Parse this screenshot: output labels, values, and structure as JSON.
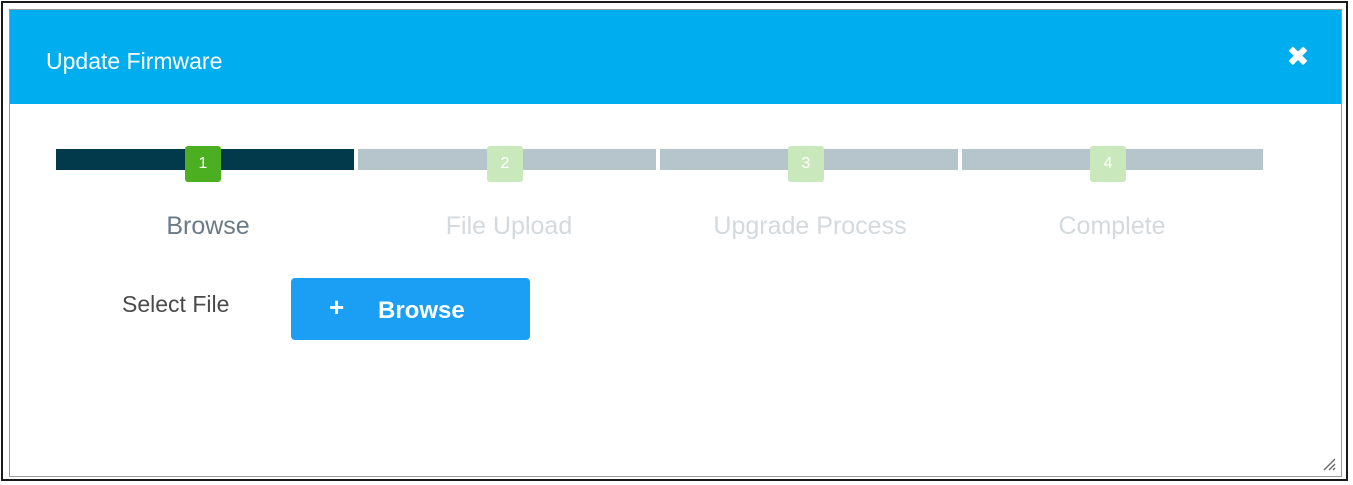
{
  "dialog": {
    "title": "Update Firmware",
    "close_icon": "close-icon",
    "close_glyph": "✖"
  },
  "stepper": {
    "current_step": 1,
    "steps": [
      {
        "number": "1",
        "label": "Browse",
        "state": "active"
      },
      {
        "number": "2",
        "label": "File Upload",
        "state": "inactive"
      },
      {
        "number": "3",
        "label": "Upgrade Process",
        "state": "inactive"
      },
      {
        "number": "4",
        "label": "Complete",
        "state": "inactive"
      }
    ]
  },
  "form": {
    "select_file_label": "Select File",
    "browse_button": {
      "icon": "plus-icon",
      "plus_glyph": "+",
      "label": "Browse"
    }
  },
  "colors": {
    "titlebar": "#00aeef",
    "step_active_bar": "#023a4c",
    "step_inactive_bar": "#b6c4cb",
    "step_active_badge": "#4caf22",
    "step_inactive_badge": "#c9e8bb",
    "browse_button": "#1b9ff4"
  }
}
